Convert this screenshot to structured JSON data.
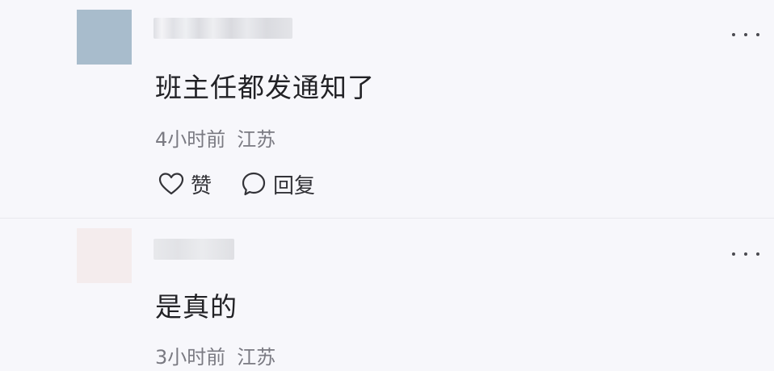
{
  "comments": [
    {
      "text": "班主任都发通知了",
      "time": "4小时前",
      "location": "江苏",
      "like_label": "赞",
      "reply_label": "回复",
      "avatar_color": "#a8bccc",
      "more_icon": "more-horizontal-icon"
    },
    {
      "text": "是真的",
      "time": "3小时前",
      "location": "江苏",
      "avatar_color": "#f4eced",
      "more_icon": "more-horizontal-icon"
    }
  ],
  "icons": {
    "like": "heart-outline-icon",
    "reply": "speech-bubble-outline-icon"
  }
}
